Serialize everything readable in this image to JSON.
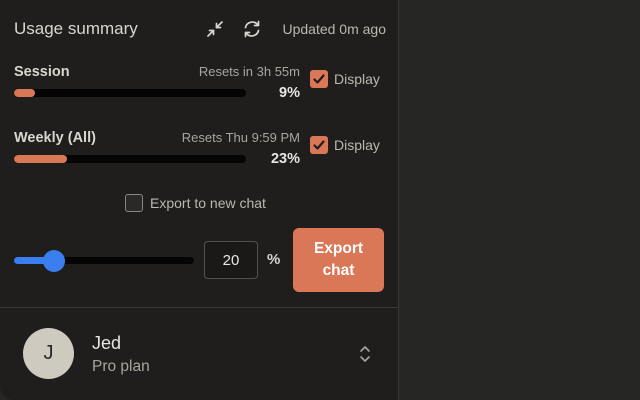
{
  "header": {
    "title": "Usage summary",
    "collapse_icon": "collapse-arrows-icon",
    "refresh_icon": "refresh-icon",
    "updated": "Updated 0m ago"
  },
  "session": {
    "label": "Session",
    "reset": "Resets in 3h 55m",
    "percent_text": "9%",
    "percent": 9,
    "display_label": "Display",
    "display_checked": true
  },
  "weekly": {
    "label": "Weekly (All)",
    "reset": "Resets Thu 9:59 PM",
    "percent_text": "23%",
    "percent": 23,
    "display_label": "Display",
    "display_checked": true
  },
  "export": {
    "new_chat_label": "Export to new chat",
    "new_chat_checked": false,
    "slider_value": 20,
    "slider_max": 100,
    "input_value": "20",
    "unit": "%",
    "button_label": "Export chat"
  },
  "user": {
    "initial": "J",
    "name": "Jed",
    "plan": "Pro plan",
    "menu_icon": "chevron-up-down-icon"
  },
  "colors": {
    "accent": "#d97757",
    "slider": "#3a7ef0",
    "panel_bg": "#1f1e1d",
    "page_bg": "#262624"
  }
}
